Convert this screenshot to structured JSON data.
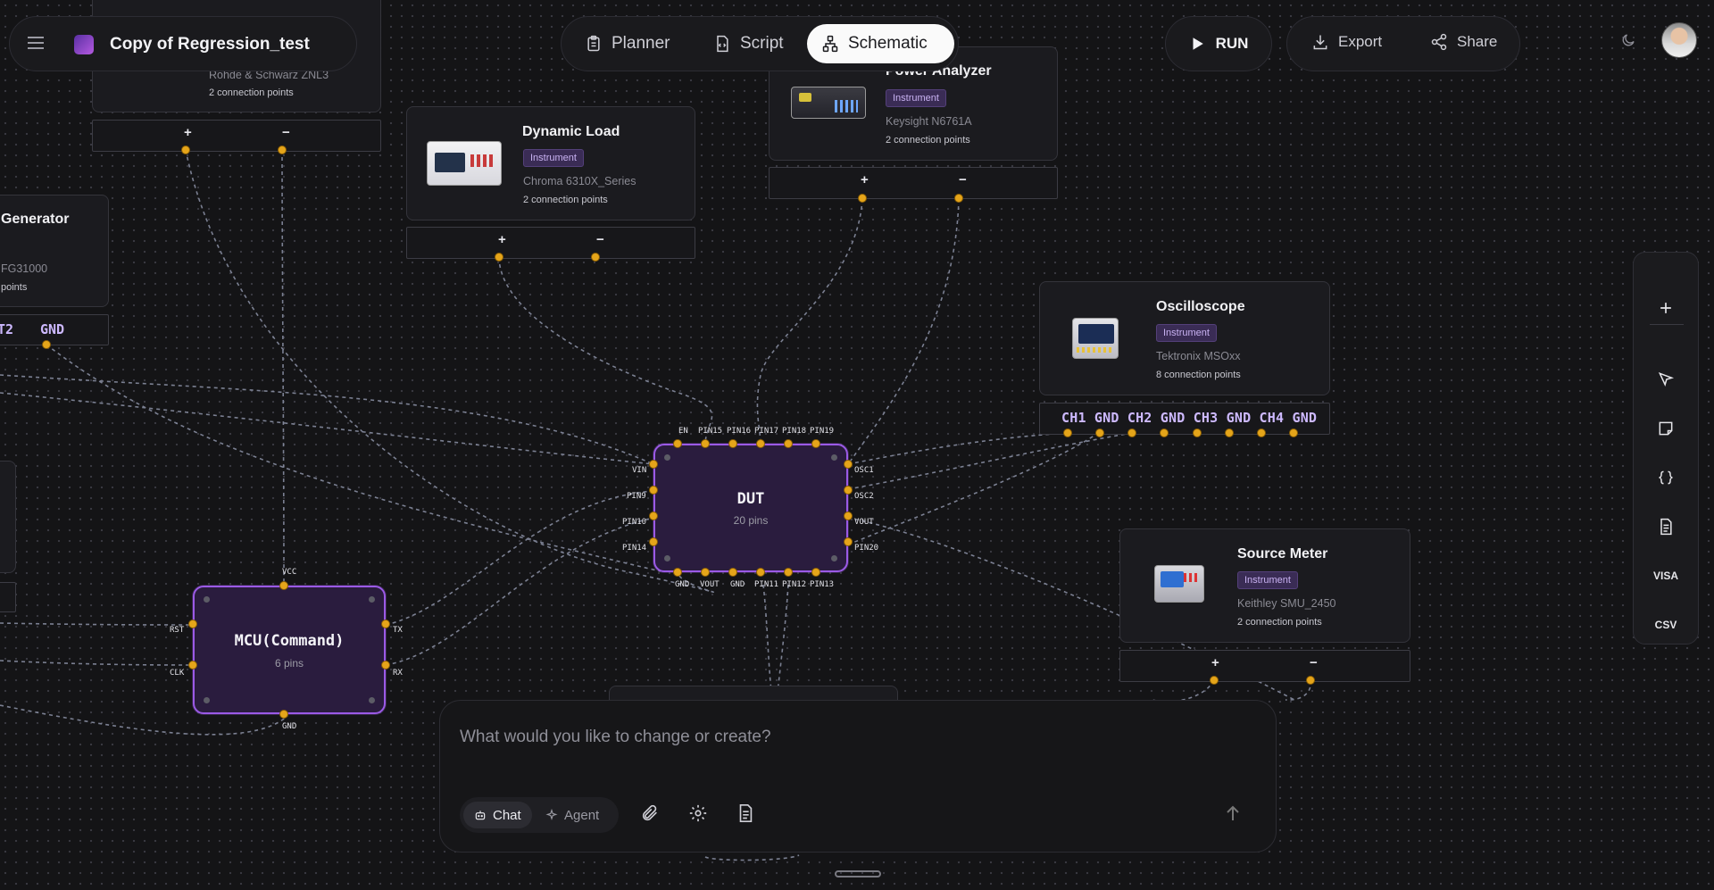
{
  "header": {
    "project_title": "Copy of Regression_test",
    "tabs": [
      {
        "label": "Planner",
        "icon": "clipboard-icon"
      },
      {
        "label": "Script",
        "icon": "script-file-icon"
      },
      {
        "label": "Schematic",
        "icon": "schematic-icon",
        "active": true
      }
    ],
    "run_label": "RUN",
    "export_label": "Export",
    "share_label": "Share"
  },
  "instruments": {
    "top_left": {
      "model": "Rohde & Schwarz ZNL3",
      "connections": "2 connection points",
      "pins": [
        "+",
        "−"
      ]
    },
    "generator": {
      "title": "Generator",
      "model": "FG31000",
      "connections": "points",
      "pins": [
        "T2",
        "GND"
      ]
    },
    "dynamic_load": {
      "title": "Dynamic Load",
      "tag": "Instrument",
      "model": "Chroma 6310X_Series",
      "connections": "2 connection points",
      "pins": [
        "+",
        "−"
      ]
    },
    "power_analyzer": {
      "title": "Power Analyzer",
      "tag": "Instrument",
      "model": "Keysight N6761A",
      "connections": "2 connection points",
      "pins": [
        "+",
        "−"
      ]
    },
    "oscilloscope": {
      "title": "Oscilloscope",
      "tag": "Instrument",
      "model": "Tektronix MSOxx",
      "connections": "8 connection points",
      "pins": "CH1 GND CH2 GND CH3 GND CH4 GND"
    },
    "source_meter": {
      "title": "Source Meter",
      "tag": "Instrument",
      "model": "Keithley SMU_2450",
      "connections": "2 connection points",
      "pins": [
        "+",
        "−"
      ]
    }
  },
  "dut": {
    "name": "DUT",
    "subtitle": "20 pins",
    "top_pins": [
      "EN",
      "PIN15",
      "PIN16",
      "PIN17",
      "PIN18",
      "PIN19"
    ],
    "left_pins": [
      "VIN",
      "PIN9",
      "PIN10",
      "PIN14"
    ],
    "right_pins": [
      "OSC1",
      "OSC2",
      "VOUT",
      "PIN20"
    ],
    "bottom_pins": [
      "GND",
      "VOUT",
      "GND",
      "PIN11",
      "PIN12",
      "PIN13"
    ]
  },
  "mcu": {
    "name": "MCU(Command)",
    "subtitle": "6 pins",
    "top_pin": "VCC",
    "left_pins": [
      "RST",
      "CLK"
    ],
    "right_pins": [
      "TX",
      "RX"
    ],
    "bottom_pin": "GND"
  },
  "toolbar": {
    "items": [
      {
        "icon": "plus-icon"
      },
      {
        "icon": "cursor-icon"
      },
      {
        "icon": "sticky-note-icon"
      },
      {
        "icon": "code-braces-icon"
      },
      {
        "icon": "document-icon"
      }
    ],
    "visa_label": "VISA",
    "csv_label": "CSV"
  },
  "chat": {
    "placeholder": "What would you like to change or create?",
    "chat_label": "Chat",
    "agent_label": "Agent"
  }
}
